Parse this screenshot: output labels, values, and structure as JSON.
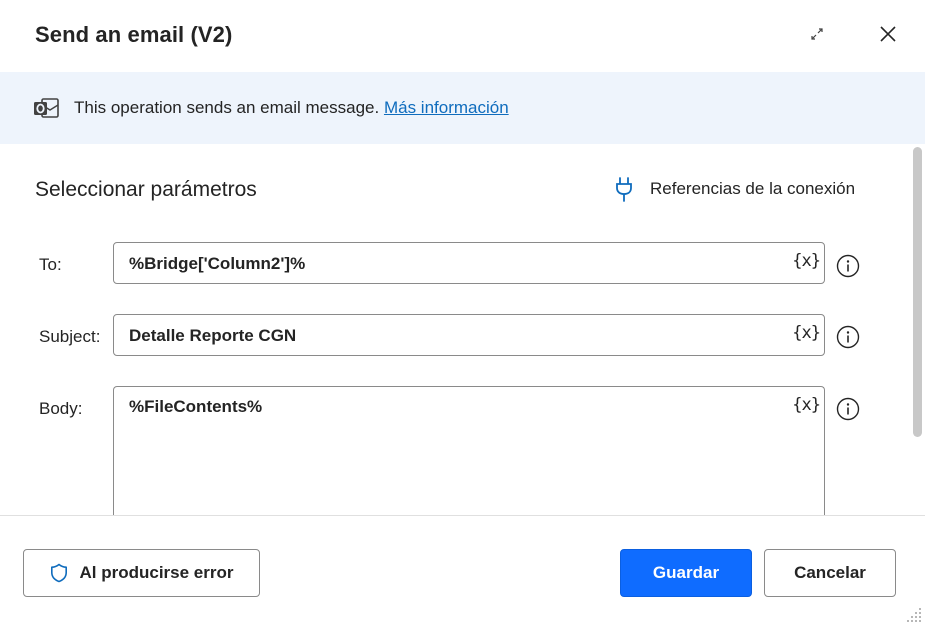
{
  "dialog": {
    "title": "Send an email (V2)",
    "expand_icon": "expand-icon",
    "close_icon": "close-icon"
  },
  "banner": {
    "icon": "outlook-icon",
    "text": "This operation sends an email message. ",
    "link": "Más información"
  },
  "section": {
    "title": "Seleccionar parámetros",
    "connection_ref_label": "Referencias de la conexión",
    "connection_ref_icon": "plug-icon"
  },
  "fields": {
    "to": {
      "label": "To:",
      "value": "%Bridge['Column2']%",
      "var_button": "{x}"
    },
    "subject": {
      "label": "Subject:",
      "value": "Detalle Reporte CGN",
      "var_button": "{x}"
    },
    "body": {
      "label": "Body:",
      "value": "%FileContents%",
      "var_button": "{x}"
    }
  },
  "footer": {
    "error_button": "Al producirse error",
    "error_icon": "shield-icon",
    "save_button": "Guardar",
    "cancel_button": "Cancelar"
  },
  "colors": {
    "accent": "#0f6cff",
    "link": "#0f6cbd",
    "banner_bg": "#eef4fc"
  }
}
